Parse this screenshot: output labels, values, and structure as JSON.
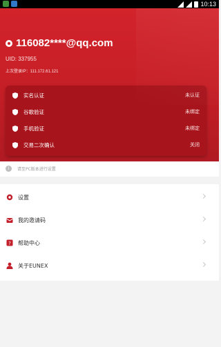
{
  "status_bar": {
    "time": "10:13"
  },
  "account": {
    "email": "116082****@qq.com",
    "uid": "UID: 337955",
    "last_login": "上次登录IP：111.172.61.121"
  },
  "security": [
    {
      "label": "实名认证",
      "status": "未认证"
    },
    {
      "label": "谷歌验证",
      "status": "未绑定"
    },
    {
      "label": "手机验证",
      "status": "未绑定"
    },
    {
      "label": "交易二次确认",
      "status": "关闭"
    }
  ],
  "notice": "请至PC版本进行设置",
  "menu": [
    {
      "label": "设置",
      "icon": "settings-icon"
    },
    {
      "label": "我的邀请码",
      "icon": "invite-icon"
    },
    {
      "label": "帮助中心",
      "icon": "help-icon"
    },
    {
      "label": "关于EUNEX",
      "icon": "user-icon"
    }
  ],
  "colors": {
    "brand_red": "#c81f27",
    "card_red": "#a8141c",
    "menu_icon": "#c21f2b"
  }
}
